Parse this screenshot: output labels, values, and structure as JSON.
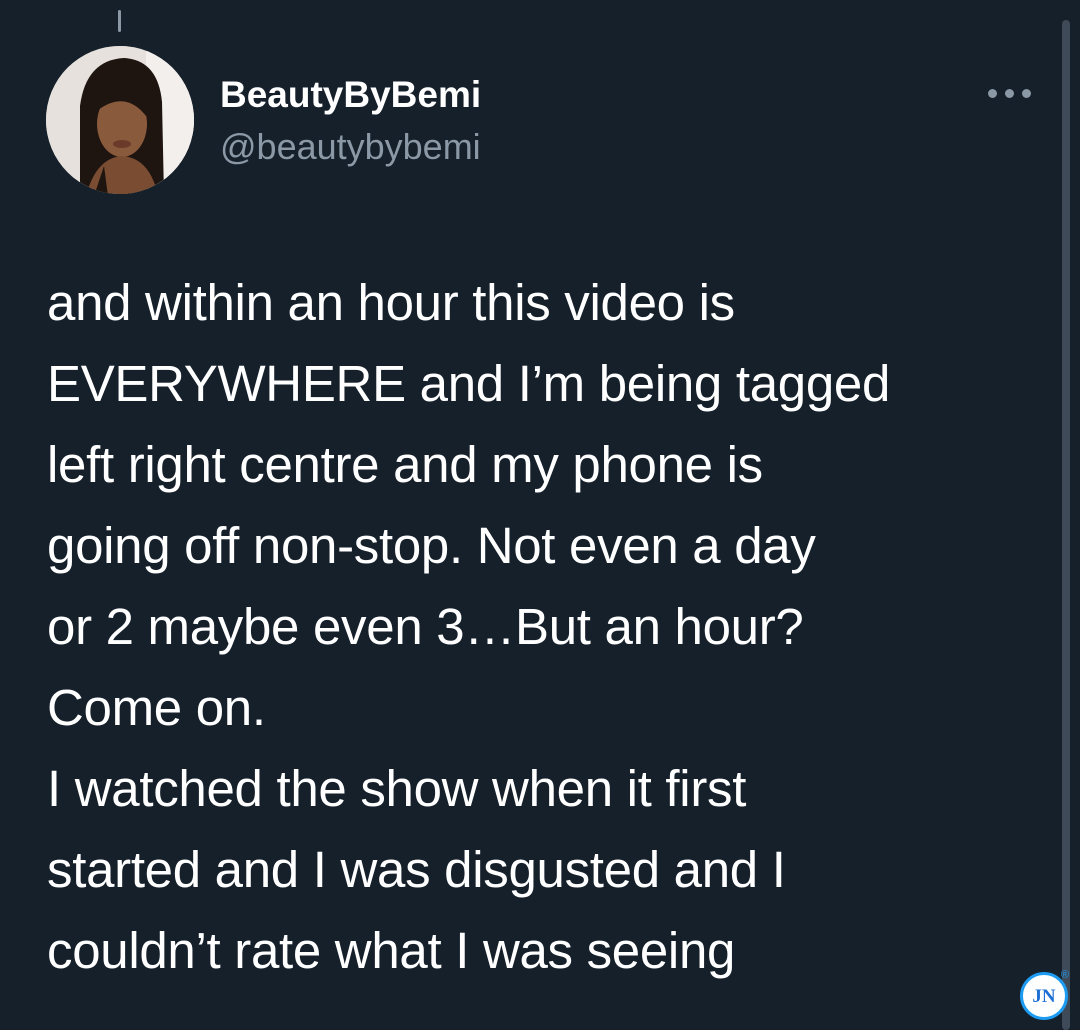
{
  "user": {
    "display_name": "BeautyByBemi",
    "handle": "@beautybybemi"
  },
  "tweet": {
    "lines": [
      "and within an hour this video is",
      "EVERYWHERE and I’m being tagged",
      "left right centre and my phone is",
      "going off non-stop. Not even a day",
      "or 2 maybe even 3…But an hour?",
      "Come on.",
      "I watched the show when it first",
      "started and I was disgusted and I",
      "couldn’t rate what I was seeing"
    ]
  },
  "icons": {
    "more": "more-horizontal-icon",
    "avatar": "profile-photo"
  },
  "watermark": {
    "text": "JN",
    "mark": "®"
  },
  "colors": {
    "background": "#15202b",
    "secondary_text": "#8b98a5",
    "accent": "#1d9bf0"
  }
}
